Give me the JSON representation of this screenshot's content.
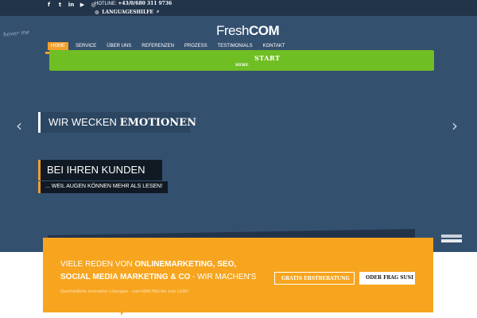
{
  "header": {
    "social": [
      {
        "icon": "facebook-icon",
        "glyph": "f"
      },
      {
        "icon": "twitter-icon",
        "glyph": "t"
      },
      {
        "icon": "linkedin-icon",
        "glyph": "in"
      },
      {
        "icon": "youtube-icon",
        "glyph": "▶"
      },
      {
        "icon": "instagram-icon",
        "glyph": "◎"
      }
    ],
    "hotline_label": "HOTLINE:",
    "hotline_number": "+43/0/680 311 9736",
    "language_label": "LANGUAGESHILFE",
    "logo_part1": "Fresh",
    "logo_part2": "COM",
    "hover_tag": "hover me"
  },
  "nav": {
    "items": [
      {
        "label": "HOME",
        "active": true
      },
      {
        "label": "SERVICE"
      },
      {
        "label": "ÜBER UNS"
      },
      {
        "label": "REFERENZEN"
      },
      {
        "label": "PROZESS"
      },
      {
        "label": "TESTIMONIALS"
      },
      {
        "label": "KONTAKT"
      }
    ]
  },
  "greenbar": {
    "start": "START",
    "here": "HERE",
    "color": "#6fbf24"
  },
  "hero": {
    "line1_prefix": "WIR WECKEN",
    "line1_strong": "EMOTIONEN",
    "line2": "BEI IHREN KUNDEN",
    "subline": "... WEIL AUGEN KÖNNEN MEHR ALS LESEN!",
    "prev_arrow": "‹",
    "next_arrow": "›"
  },
  "cta": {
    "line1_prefix": "VIELE REDEN VON",
    "line1_bold": "ONLINEMARKETING, SEO,",
    "line2_bold": "SOCIAL MEDIA MARKETING & CO",
    "line2_suffix": "- WIR MACHEN'S",
    "small": "Ganzheitliche innovative Lösungen - vom MAILING bis zum LEAD",
    "btn_outline": "GRATIS ERSTBERATUNG",
    "btn_solid": "ODER FRAG SUSI",
    "color": "#f7a51f"
  }
}
